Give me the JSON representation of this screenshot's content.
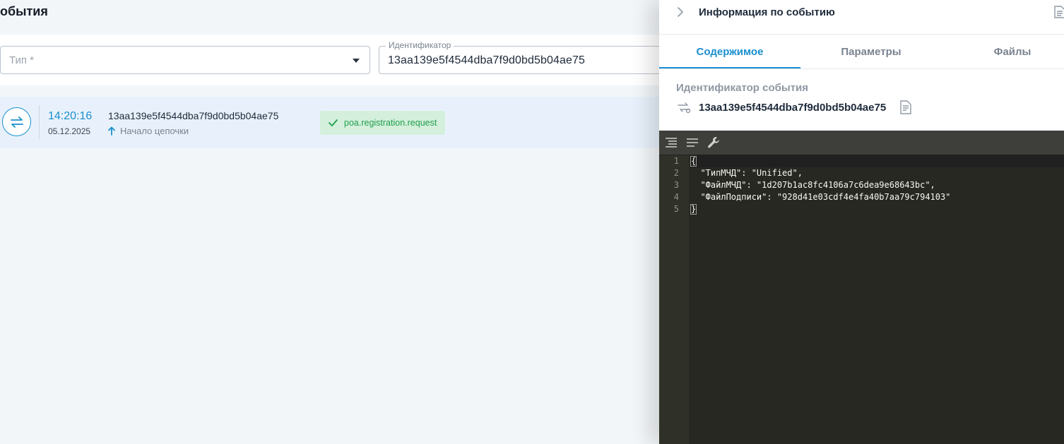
{
  "page": {
    "title": "обытия"
  },
  "filters": {
    "type_placeholder": "Тип *",
    "id_label": "Идентификатор",
    "id_value": "13aa139e5f4544dba7f9d0bd5b04ae75"
  },
  "events": [
    {
      "time": "14:20:16",
      "date": "05.12.2025",
      "id": "13aa139e5f4544dba7f9d0bd5b04ae75",
      "chain_label": "Начало цепочки",
      "tag": "poa.registration.request"
    }
  ],
  "panel": {
    "title": "Информация по событию",
    "tabs": [
      {
        "label": "Содержимое",
        "active": true
      },
      {
        "label": "Параметры",
        "active": false
      },
      {
        "label": "Файлы",
        "active": false
      }
    ],
    "event_id_label": "Идентификатор события",
    "event_id": "13aa139e5f4544dba7f9d0bd5b04ae75"
  },
  "editor": {
    "line_numbers": [
      "1",
      "2",
      "3",
      "4",
      "5"
    ],
    "lines": [
      "{",
      "  \"ТипМЧД\": \"Unified\",",
      "  \"ФайлМЧД\": \"1d207b1ac8fc4106a7c6dea9e68643bc\",",
      "  \"ФайлПодписи\": \"928d41e03cdf4e4fa40b7aa79c794103\"",
      "}"
    ]
  },
  "colors": {
    "accent": "#1a8fcf",
    "tag_bg": "#d4f0dc",
    "tag_text": "#1f9d4c",
    "row_highlight": "#e8f1fb",
    "editor_bg": "#272822"
  },
  "icons": [
    "exchange-arrows-icon",
    "arrow-up-icon",
    "checkmark-icon",
    "chevron-right-icon",
    "document-lines-icon",
    "link-arrows-icon",
    "copy-document-icon",
    "format-indent-icon",
    "compact-lines-icon",
    "wrench-icon"
  ]
}
